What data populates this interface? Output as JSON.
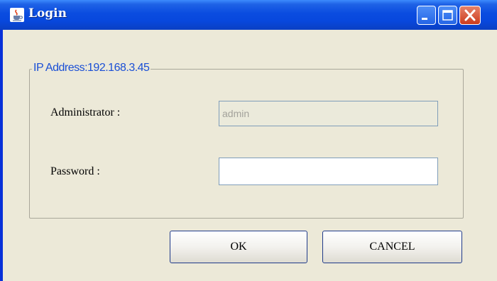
{
  "window": {
    "title": "Login",
    "title_icon": "java-cup-icon",
    "controls": [
      "minimize-icon",
      "maximize-icon",
      "close-icon"
    ]
  },
  "group": {
    "legend": "IP Address:192.168.3.45"
  },
  "form": {
    "admin_label": "Administrator :",
    "admin_value": "admin",
    "password_label": "Password :",
    "password_value": ""
  },
  "buttons": {
    "ok": "OK",
    "cancel": "CANCEL"
  },
  "colors": {
    "titlebar": "#0a4ce0",
    "close": "#cc3b1c",
    "legend_text": "#1a4fd6",
    "window_bg": "#ece9d8"
  }
}
